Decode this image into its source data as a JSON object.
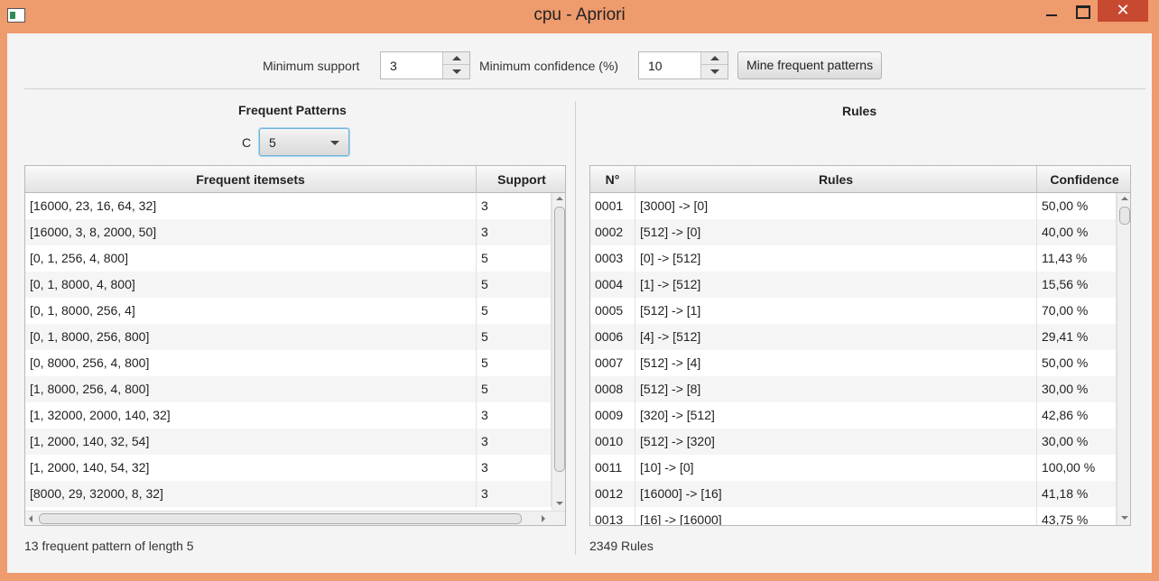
{
  "window": {
    "title": "cpu - Apriori",
    "close_glyph": "✕"
  },
  "controls": {
    "min_support_label": "Minimum support",
    "min_support_value": "3",
    "min_confidence_label": "Minimum confidence (%)",
    "min_confidence_value": "10",
    "mine_button": "Mine frequent patterns"
  },
  "patterns": {
    "title": "Frequent Patterns",
    "c_label": "C",
    "c_value": "5",
    "columns": [
      "Frequent itemsets",
      "Support"
    ],
    "rows": [
      [
        "[16000, 23, 16, 64, 32]",
        "3"
      ],
      [
        "[16000, 3, 8, 2000, 50]",
        "3"
      ],
      [
        "[0, 1, 256, 4, 800]",
        "5"
      ],
      [
        "[0, 1, 8000, 4, 800]",
        "5"
      ],
      [
        "[0, 1, 8000, 256, 4]",
        "5"
      ],
      [
        "[0, 1, 8000, 256, 800]",
        "5"
      ],
      [
        "[0, 8000, 256, 4, 800]",
        "5"
      ],
      [
        "[1, 8000, 256, 4, 800]",
        "5"
      ],
      [
        "[1, 32000, 2000, 140, 32]",
        "3"
      ],
      [
        "[1, 2000, 140, 32, 54]",
        "3"
      ],
      [
        "[1, 2000, 140, 54, 32]",
        "3"
      ],
      [
        "[8000, 29, 32000, 8, 32]",
        "3"
      ]
    ],
    "status": "13 frequent pattern of length 5"
  },
  "rules": {
    "title": "Rules",
    "columns": [
      "N°",
      "Rules",
      "Confidence"
    ],
    "rows": [
      [
        "0001",
        "[3000] -> [0]",
        "50,00 %"
      ],
      [
        "0002",
        "[512] -> [0]",
        "40,00 %"
      ],
      [
        "0003",
        "[0] -> [512]",
        "11,43 %"
      ],
      [
        "0004",
        "[1] -> [512]",
        "15,56 %"
      ],
      [
        "0005",
        "[512] -> [1]",
        "70,00 %"
      ],
      [
        "0006",
        "[4] -> [512]",
        "29,41 %"
      ],
      [
        "0007",
        "[512] -> [4]",
        "50,00 %"
      ],
      [
        "0008",
        "[512] -> [8]",
        "30,00 %"
      ],
      [
        "0009",
        "[320] -> [512]",
        "42,86 %"
      ],
      [
        "0010",
        "[512] -> [320]",
        "30,00 %"
      ],
      [
        "0011",
        "[10] -> [0]",
        "100,00 %"
      ],
      [
        "0012",
        "[16000] -> [16]",
        "41,18 %"
      ],
      [
        "0013",
        "[16] -> [16000]",
        "43,75 %"
      ]
    ],
    "status": "2349 Rules"
  }
}
